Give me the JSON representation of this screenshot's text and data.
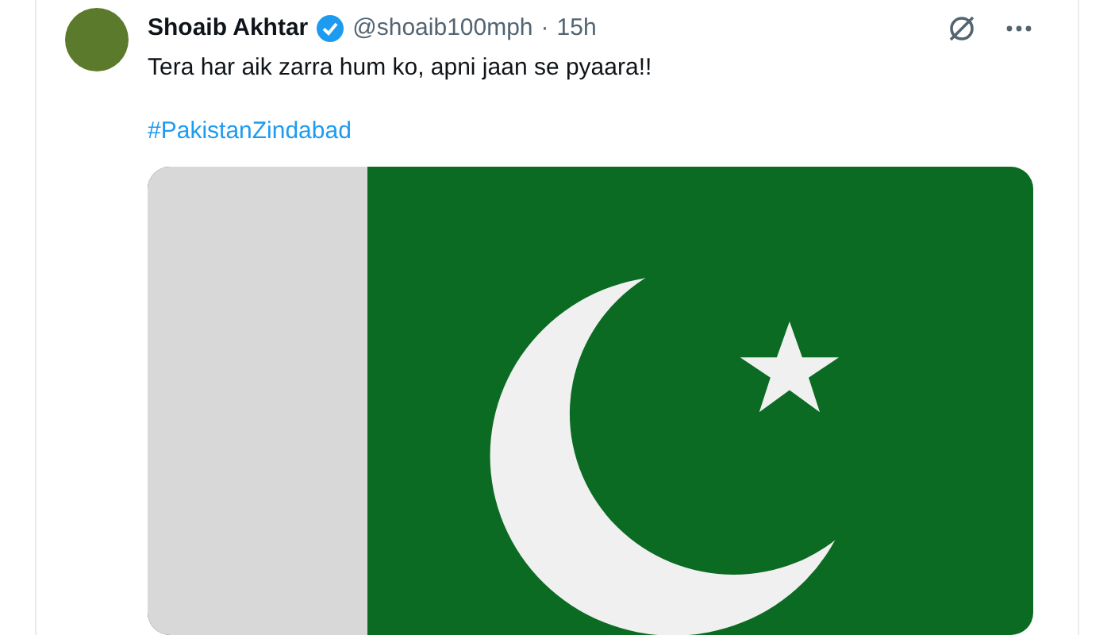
{
  "post": {
    "author": {
      "name": "Shoaib Akhtar",
      "verified": true,
      "handle": "@shoaib100mph",
      "separator": "·",
      "time": "15h"
    },
    "text": "Tera har aik zarra hum ko, apni jaan se pyaara!!",
    "hashtag": "#PakistanZindabad"
  }
}
